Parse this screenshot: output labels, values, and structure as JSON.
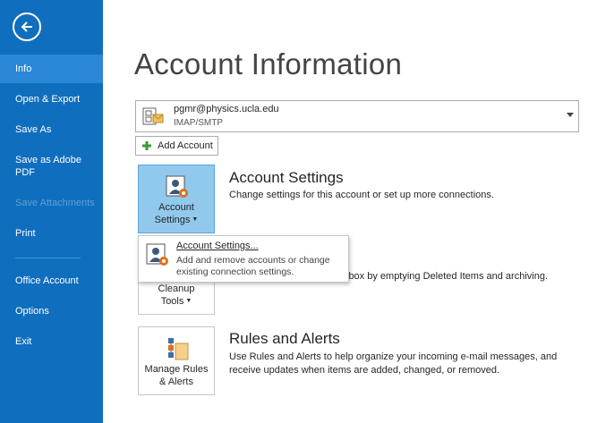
{
  "sidebar": {
    "items": [
      {
        "label": "Info"
      },
      {
        "label": "Open & Export"
      },
      {
        "label": "Save As"
      },
      {
        "label": "Save as Adobe PDF"
      },
      {
        "label": "Save Attachments"
      },
      {
        "label": "Print"
      },
      {
        "label": "Office Account"
      },
      {
        "label": "Options"
      },
      {
        "label": "Exit"
      }
    ]
  },
  "main": {
    "title": "Account Information",
    "account": {
      "email": "pgmr@physics.ucla.edu",
      "type": "IMAP/SMTP"
    },
    "add_account_label": "Add Account",
    "account_settings": {
      "tile_line1": "Account",
      "tile_line2": "Settings",
      "title": "Account Settings",
      "description": "Change settings for this account or set up more connections."
    },
    "cleanup": {
      "tile_line1": "Cleanup",
      "tile_line2": "Tools",
      "description": "lbox by emptying Deleted Items and archiving."
    },
    "rules": {
      "tile_line1": "Manage Rules",
      "tile_line2": "& Alerts",
      "title": "Rules and Alerts",
      "description": "Use Rules and Alerts to help organize your incoming e-mail messages, and receive updates when items are added, changed, or removed."
    }
  },
  "menu": {
    "title": "Account Settings...",
    "description": "Add and remove accounts or change existing connection settings."
  },
  "colors": {
    "sidebar": "#106ebe",
    "sidebar_active": "#2b88d8",
    "tile_selected": "#91c9ed"
  }
}
